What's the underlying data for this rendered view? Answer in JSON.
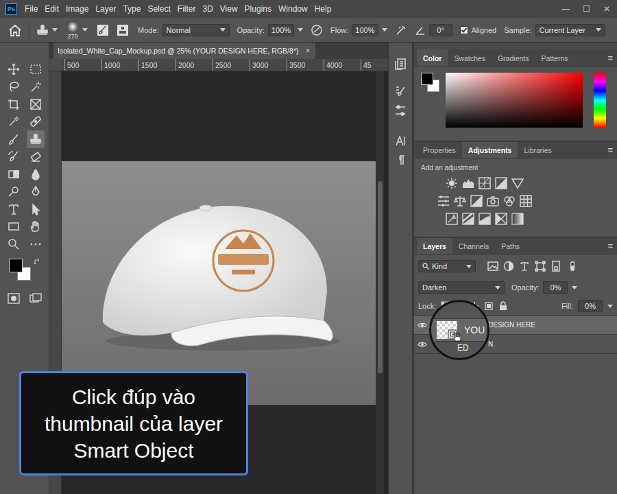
{
  "app": {
    "logo": "Ps"
  },
  "menu": [
    "File",
    "Edit",
    "Image",
    "Layer",
    "Type",
    "Select",
    "Filter",
    "3D",
    "View",
    "Plugins",
    "Window",
    "Help"
  ],
  "window_controls": [
    "—",
    "☐",
    "✕"
  ],
  "options_bar": {
    "brush_size": "270",
    "mode_label": "Mode:",
    "mode": "Normal",
    "opacity_label": "Opacity:",
    "opacity": "100%",
    "flow_label": "Flow:",
    "flow": "100%",
    "angle": "0°",
    "aligned": {
      "label": "Aligned",
      "checked": true
    },
    "sample_label": "Sample:",
    "sample": "Current Layer"
  },
  "toolbar": {
    "tools": [
      {
        "selected": false
      },
      {
        "selected": false
      },
      {
        "selected": false
      },
      {
        "selected": false
      },
      {
        "selected": false
      },
      {
        "selected": false
      },
      {
        "selected": false
      },
      {
        "selected": false
      },
      {
        "selected": false
      },
      {
        "selected": true
      },
      {
        "selected": false
      },
      {
        "selected": false
      },
      {
        "selected": false
      },
      {
        "selected": false
      },
      {
        "selected": false
      },
      {
        "selected": false
      },
      {
        "selected": false
      },
      {
        "selected": false
      },
      {
        "selected": false
      },
      {
        "selected": false
      },
      {
        "selected": false
      },
      {
        "selected": false
      }
    ]
  },
  "document": {
    "tab": {
      "title": "Isolated_White_Cap_Mockup.psd @ 25% (YOUR DESIGN HERE, RGB/8*)",
      "close": "×",
      "selected": true
    },
    "ruler": [
      "500",
      "1000",
      "1500",
      "2000",
      "2500",
      "3000",
      "3500",
      "4000",
      "45"
    ]
  },
  "color_panel": {
    "tabs": [
      {
        "label": "Color",
        "selected": true
      },
      {
        "label": "Swatches",
        "selected": false
      },
      {
        "label": "Gradients",
        "selected": false
      },
      {
        "label": "Patterns",
        "selected": false
      }
    ],
    "menu": "≡"
  },
  "adjust_panel": {
    "tabs": [
      {
        "label": "Properties",
        "selected": false
      },
      {
        "label": "Adjustments",
        "selected": true
      },
      {
        "label": "Libraries",
        "selected": false
      }
    ],
    "menu": "≡",
    "hint": "Add an adjustment"
  },
  "layers_panel": {
    "tabs": [
      {
        "label": "Layers",
        "selected": true
      },
      {
        "label": "Channels",
        "selected": false
      },
      {
        "label": "Paths",
        "selected": false
      }
    ],
    "menu": "≡",
    "filter": "Kind",
    "blend_mode": "Darken",
    "opacity_label": "Opacity:",
    "opacity": "0%",
    "lock_label": "Lock:",
    "fill_label": "Fill:",
    "fill": "0%",
    "layers": [
      {
        "name": "DESIGN HERE",
        "visible": true,
        "selected": true
      },
      {
        "name": "N",
        "visible": true,
        "selected": false
      }
    ]
  },
  "magnifier": {
    "texts": [
      "YOU",
      "ED"
    ]
  },
  "caption": "Click đúp vào thumbnail của layer Smart Object"
}
